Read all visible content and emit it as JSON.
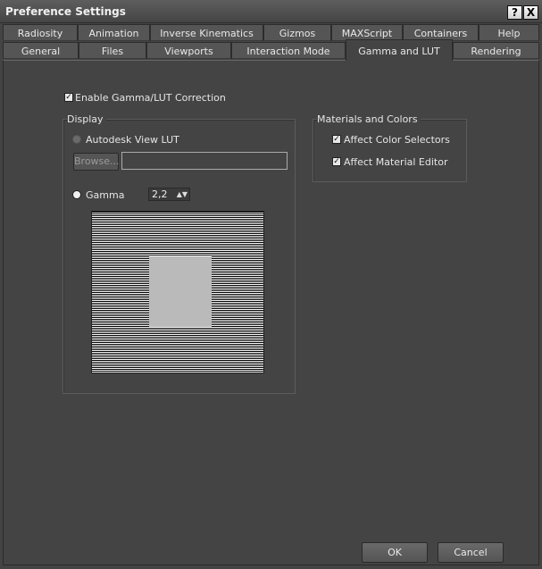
{
  "window": {
    "title": "Preference Settings",
    "help_glyph": "?",
    "close_glyph": "X"
  },
  "tabs_row1": [
    "Radiosity",
    "Animation",
    "Inverse Kinematics",
    "Gizmos",
    "MAXScript",
    "Containers",
    "Help"
  ],
  "tabs_row2": [
    "General",
    "Files",
    "Viewports",
    "Interaction Mode",
    "Gamma and LUT",
    "Rendering"
  ],
  "active_tab": "Gamma and LUT",
  "enable_gamma": {
    "label": "Enable Gamma/LUT Correction",
    "checked": true,
    "check_glyph": "✓"
  },
  "display": {
    "group_label": "Display",
    "lut_label": "Autodesk View LUT",
    "browse_label": "Browse...",
    "lut_path": "",
    "gamma_label": "Gamma",
    "gamma_value": "2,2",
    "spinner_glyph": "▲▼"
  },
  "materials": {
    "group_label": "Materials and Colors",
    "affect_color_selectors": {
      "label": "Affect Color Selectors",
      "checked": true
    },
    "affect_material_editor": {
      "label": "Affect Material Editor",
      "checked": true
    }
  },
  "footer": {
    "ok_label": "OK",
    "cancel_label": "Cancel"
  },
  "colors": {
    "background": "#444444",
    "tab": "#555555",
    "preview_gray": "#bababa"
  }
}
